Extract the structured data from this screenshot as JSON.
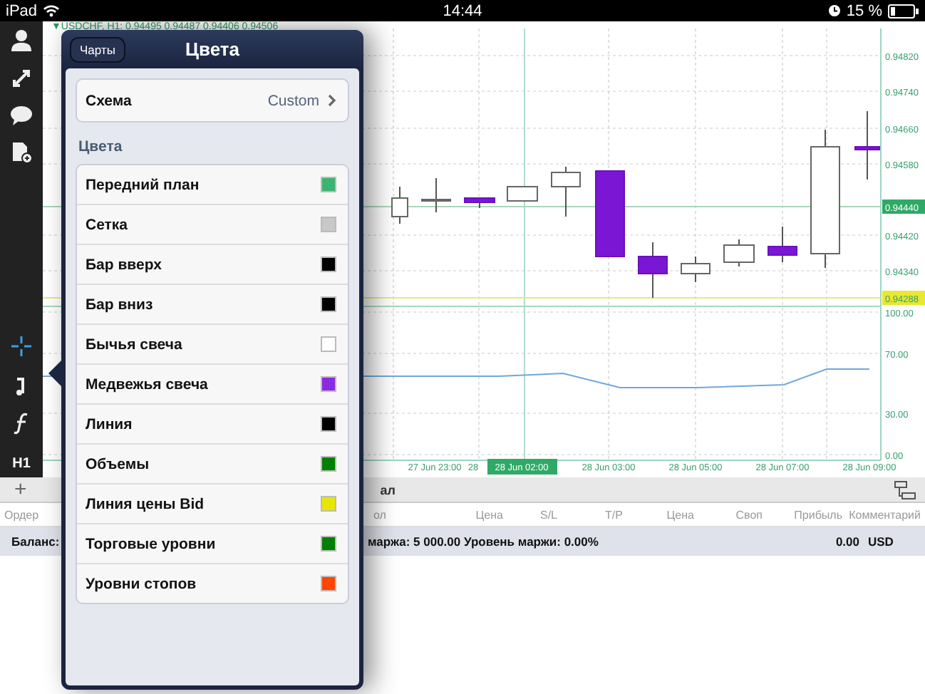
{
  "status_bar": {
    "device": "iPad",
    "time": "14:44",
    "battery": "15 %"
  },
  "toolbar": {
    "timeframe": "H1"
  },
  "chart": {
    "header": "▼USDCHF, H1: 0.94495 0.94487 0.94406 0.94506",
    "price_labels": [
      "0.94820",
      "0.94740",
      "0.94660",
      "0.94580",
      "0.94420",
      "0.94340"
    ],
    "bid_badge": "0.94440",
    "level_badge": "0.94288",
    "indicator_labels": [
      "100.00",
      "70.00",
      "30.00",
      "0.00"
    ],
    "time_labels": [
      "27 Jun 23:00",
      "28",
      "28 Jun 03:00",
      "28 Jun 05:00",
      "28 Jun 07:00",
      "28 Jun 09:00"
    ],
    "time_badge": "28 Jun 02:00"
  },
  "terminal": {
    "add": "+",
    "tab": "ал",
    "columns": [
      "Ордер",
      "ол",
      "Цена",
      "S/L",
      "T/P",
      "Цена",
      "Своп",
      "Прибыль",
      "Комментарий"
    ],
    "balance_label": "Баланс:",
    "margin_text": "маржа: 5 000.00 Уровень маржи: 0.00%",
    "profit": "0.00",
    "currency": "USD"
  },
  "popover": {
    "back": "Чарты",
    "title": "Цвета",
    "scheme_label": "Схема",
    "scheme_value": "Custom",
    "section": "Цвета",
    "colors": [
      {
        "label": "Передний план",
        "color": "#3cb371"
      },
      {
        "label": "Сетка",
        "color": "#c8c8c8"
      },
      {
        "label": "Бар вверх",
        "color": "#000000"
      },
      {
        "label": "Бар вниз",
        "color": "#000000"
      },
      {
        "label": "Бычья свеча",
        "color": "#ffffff"
      },
      {
        "label": "Медвежья свеча",
        "color": "#8a2be2"
      },
      {
        "label": "Линия",
        "color": "#000000"
      },
      {
        "label": "Объемы",
        "color": "#008000"
      },
      {
        "label": "Линия цены Bid",
        "color": "#e6e600"
      },
      {
        "label": "Торговые уровни",
        "color": "#008000"
      },
      {
        "label": "Уровни стопов",
        "color": "#ff4500"
      }
    ]
  }
}
